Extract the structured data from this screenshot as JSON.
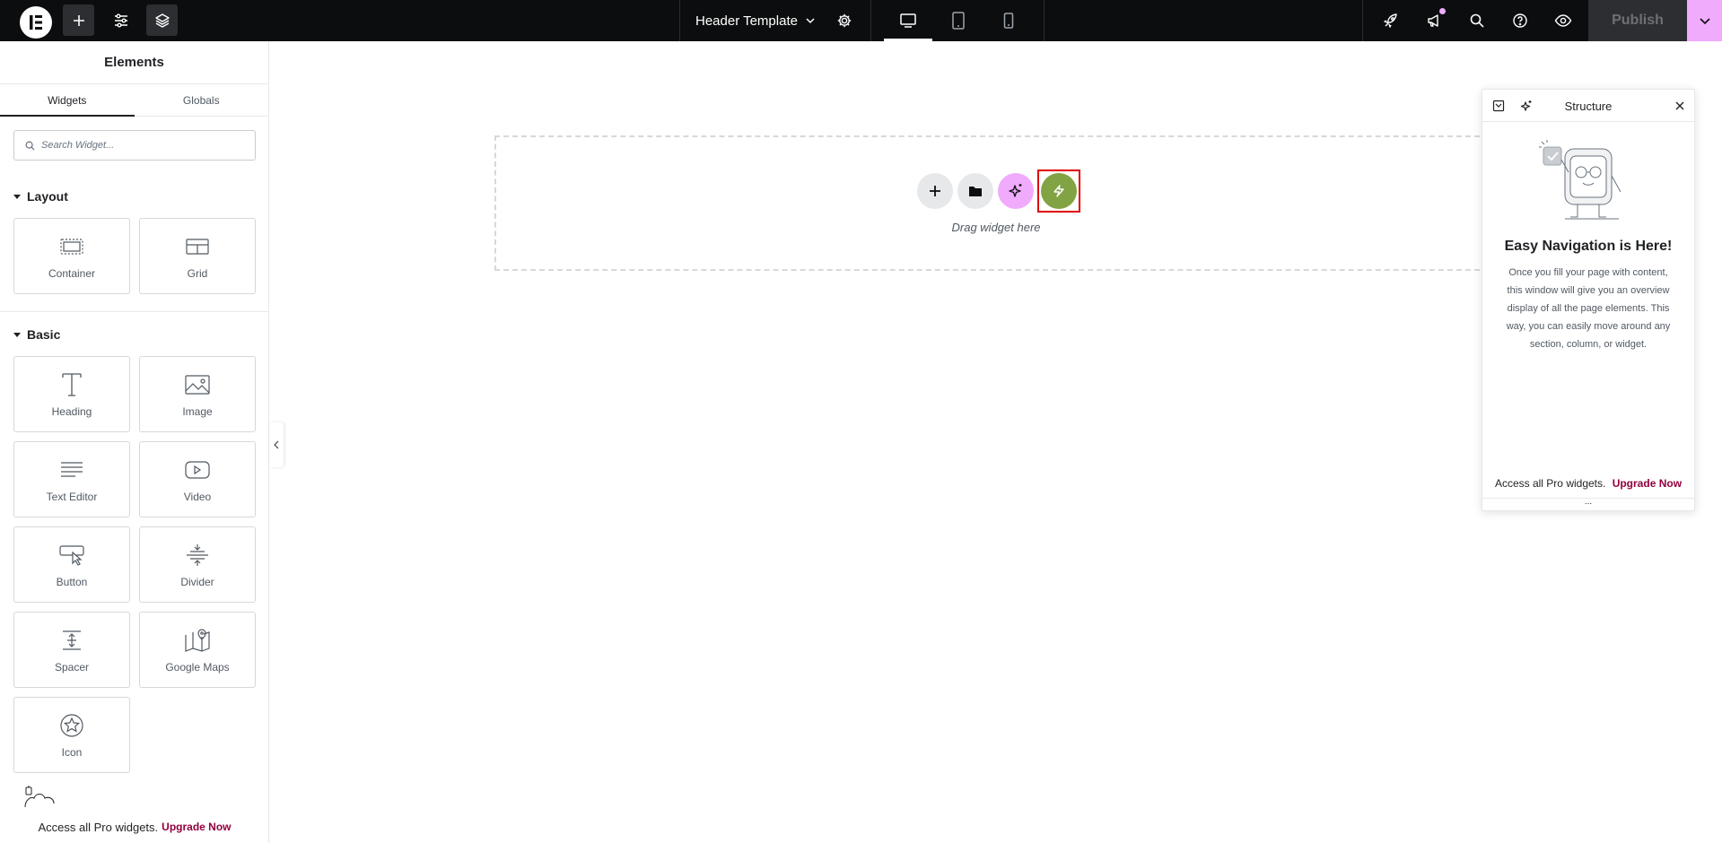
{
  "topbar": {
    "document_title": "Header Template",
    "publish_label": "Publish",
    "active_device": "desktop",
    "icons": [
      "elementor-logo-icon",
      "plus-icon",
      "sliders-icon",
      "layers-icon",
      "chevron-down-icon",
      "gear-icon",
      "desktop-icon",
      "tablet-icon",
      "mobile-icon",
      "rocket-icon",
      "megaphone-icon",
      "search-icon",
      "help-icon",
      "eye-icon",
      "chevron-down-icon"
    ],
    "colors": {
      "bar": "#0c0d0e",
      "accent_pink": "#f0abfc",
      "publish_bg": "#2d2e31"
    }
  },
  "panel": {
    "title": "Elements",
    "tabs": [
      {
        "label": "Widgets",
        "active": true
      },
      {
        "label": "Globals",
        "active": false
      }
    ],
    "search_placeholder": "Search Widget...",
    "categories": [
      {
        "name": "Layout",
        "widgets": [
          {
            "label": "Container",
            "icon": "container-icon"
          },
          {
            "label": "Grid",
            "icon": "grid-icon"
          }
        ]
      },
      {
        "name": "Basic",
        "widgets": [
          {
            "label": "Heading",
            "icon": "heading-icon"
          },
          {
            "label": "Image",
            "icon": "image-icon"
          },
          {
            "label": "Text Editor",
            "icon": "text-editor-icon"
          },
          {
            "label": "Video",
            "icon": "video-icon"
          },
          {
            "label": "Button",
            "icon": "button-icon"
          },
          {
            "label": "Divider",
            "icon": "divider-icon"
          },
          {
            "label": "Spacer",
            "icon": "spacer-icon"
          },
          {
            "label": "Google Maps",
            "icon": "map-icon"
          },
          {
            "label": "Icon",
            "icon": "star-icon"
          }
        ]
      }
    ],
    "footer": {
      "text": "Access all Pro widgets.",
      "link": "Upgrade Now"
    }
  },
  "canvas": {
    "drag_text": "Drag widget here",
    "actions": [
      "add-section",
      "template-library",
      "ai",
      "app-launch"
    ],
    "colors": {
      "ai_circle": "#f0abfc",
      "app_circle": "#81a343",
      "highlight_border": "#e00000"
    }
  },
  "structure": {
    "title": "Structure",
    "heading": "Easy Navigation is Here!",
    "body": "Once you fill your page with content, this window will give you an overview display of all the page elements. This way, you can easily move around any section, column, or widget.",
    "footer": {
      "text": "Access all Pro widgets.",
      "link": "Upgrade Now"
    },
    "dots": "..."
  }
}
